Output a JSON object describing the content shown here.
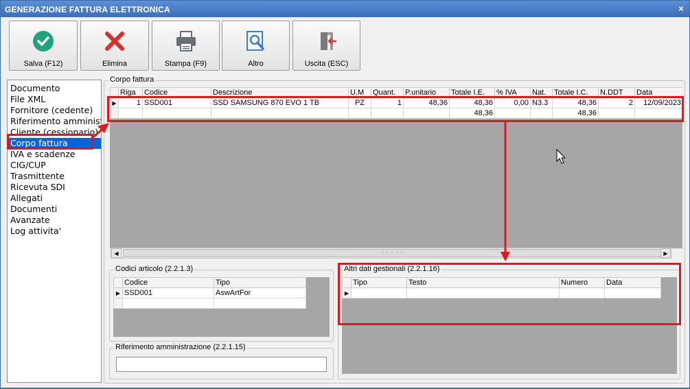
{
  "window": {
    "title": "GENERAZIONE FATTURA ELETTRONICA",
    "close_glyph": "×"
  },
  "toolbar": [
    {
      "label": "Salva (F12)",
      "icon": "check-circle-icon",
      "color": "#1fa37a"
    },
    {
      "label": "Elimina",
      "icon": "x-icon",
      "color": "#d9302c"
    },
    {
      "label": "Stampa (F9)",
      "icon": "printer-icon",
      "color": "#6a6f76"
    },
    {
      "label": "Altro",
      "icon": "magnifier-doc-icon",
      "color": "#3a7bd5"
    },
    {
      "label": "Uscita (ESC)",
      "icon": "exit-door-icon",
      "color": "#d9302c"
    }
  ],
  "sidebar": {
    "items": [
      {
        "label": "Documento"
      },
      {
        "label": "File XML"
      },
      {
        "label": "Fornitore (cedente)"
      },
      {
        "label": "Riferimento amministrazione"
      },
      {
        "label": "Cliente (cessionario)"
      },
      {
        "label": "Corpo fattura"
      },
      {
        "label": "IVA e scadenze"
      },
      {
        "label": "CIG/CUP"
      },
      {
        "label": "Trasmittente"
      },
      {
        "label": "Ricevuta SDI"
      },
      {
        "label": "Allegati"
      },
      {
        "label": "Documenti"
      },
      {
        "label": "Avanzate"
      },
      {
        "label": "Log attivita'"
      }
    ],
    "selected": "Corpo fattura"
  },
  "corpo": {
    "title": "Corpo fattura",
    "columns": [
      "Riga",
      "Codice",
      "Descrizione",
      "U.M",
      "Quant.",
      "P.unitario",
      "Totale I.E.",
      "% IVA",
      "Nat.",
      "Totale I.C.",
      "N.DDT",
      "Data"
    ],
    "row": [
      "1",
      "SSD001",
      "SSD SAMSUNG 870 EVO 1 TB",
      "PZ",
      "1",
      "48,36",
      "48,36",
      "0,00",
      "N3.3",
      "48,36",
      "2",
      "12/09/2023"
    ],
    "totals": {
      "totale_ie": "48,36",
      "totale_ic": "48,36"
    },
    "scroll_grip": "⋮⋮⋮⋮⋮"
  },
  "codici": {
    "title": "Codici articolo (2.2.1.3)",
    "columns": [
      "Codice",
      "Tipo"
    ],
    "row": [
      "SSD001",
      "AswArtFor"
    ]
  },
  "altri": {
    "title": "Altri dati gestionali (2.2.1.16)",
    "columns": [
      "Tipo",
      "Testo",
      "Numero",
      "Data"
    ]
  },
  "riferimento": {
    "title": "Riferimento amministrazione (2.2.1.15)",
    "value": ""
  },
  "annotation_color": "#e4161b"
}
